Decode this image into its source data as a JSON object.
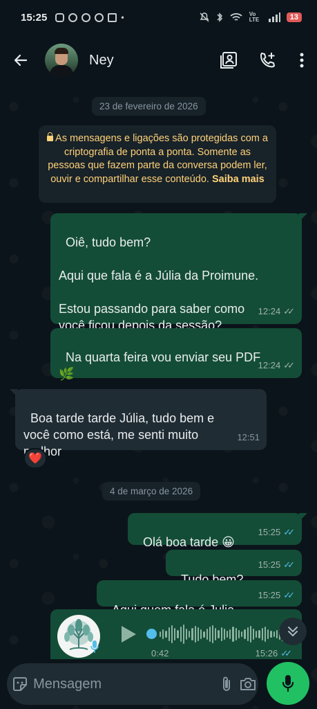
{
  "status_bar": {
    "time": "15:25",
    "signal_label": "Vo LTE",
    "battery": "13"
  },
  "header": {
    "contact_name": "Ney",
    "icons": [
      "back-arrow-icon",
      "contact-card-icon",
      "add-call-icon",
      "more-vert-icon"
    ]
  },
  "dates": {
    "first": "23 de fevereiro de 2026",
    "second": "4 de março de 2026"
  },
  "encryption_notice": {
    "text": "As mensagens e ligações são protegidas com a criptografia de ponta a ponta. Somente as pessoas que fazem parte da conversa podem ler, ouvir e compartilhar esse conteúdo.",
    "link": "Saiba mais"
  },
  "messages": [
    {
      "direction": "out",
      "text": "Oiê, tudo bem?\n\nAqui que fala é a Júlia da Proimune.\n\nEstou passando para saber como\nvocê ficou depois da sessão?",
      "time": "12:24",
      "status": "delivered"
    },
    {
      "direction": "out",
      "text": "Na quarta feira vou enviar seu PDF\n🌿",
      "time": "12:24",
      "status": "delivered"
    },
    {
      "direction": "in",
      "text": "Boa tarde tarde Júlia, tudo bem e\nvocê como está, me senti muito\nmelhor",
      "time": "12:51",
      "reaction": "❤️"
    },
    {
      "direction": "out",
      "text": "Olá boa tarde 😀",
      "time": "15:25",
      "status": "read"
    },
    {
      "direction": "out",
      "text": "Tudo bem?",
      "time": "15:25",
      "status": "read"
    },
    {
      "direction": "out",
      "text": "Aqui quem fala é Julia",
      "time": "15:25",
      "status": "read"
    }
  ],
  "voice_message": {
    "duration": "0:42",
    "time": "15:26",
    "status": "read",
    "progress": 0.0
  },
  "composer": {
    "placeholder": "Mensagem"
  },
  "colors": {
    "background": "#0b141a",
    "outgoing_bubble": "#144d37",
    "incoming_bubble": "#202c33",
    "accent_green": "#21c063",
    "read_ticks": "#53bdeb",
    "notice_text": "#ffd279"
  }
}
